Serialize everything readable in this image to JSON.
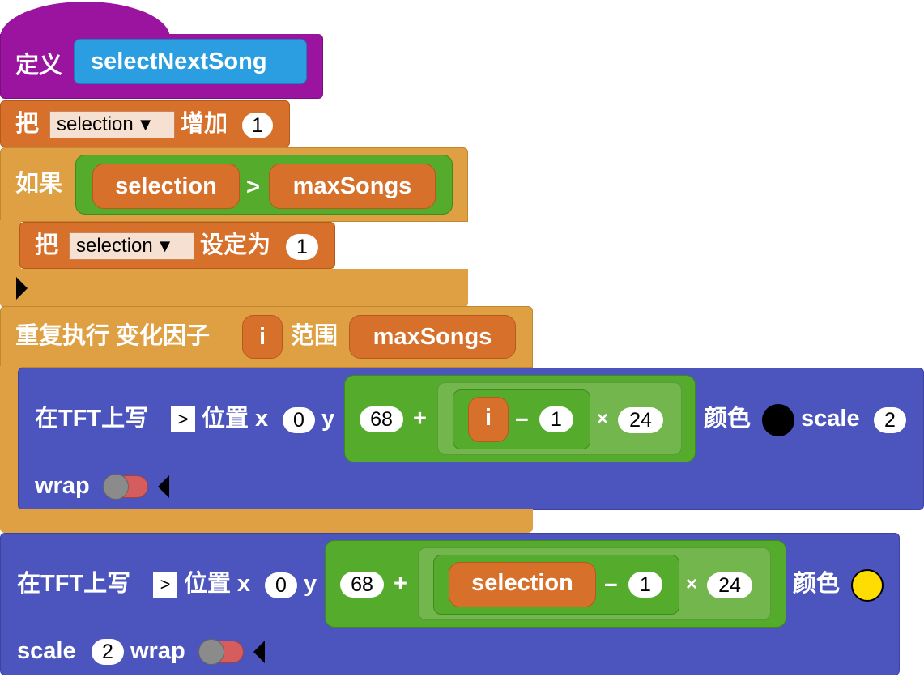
{
  "define_block": {
    "keyword": "定义",
    "name": "selectNextSong"
  },
  "change_block": {
    "keyword": "把",
    "variable": "selection",
    "action": "增加",
    "value": "1"
  },
  "if_block": {
    "keyword": "如果",
    "left": "selection",
    "operator": ">",
    "right": "maxSongs",
    "set_block": {
      "keyword": "把",
      "variable": "selection",
      "action": "设定为",
      "value": "1"
    }
  },
  "repeat_block": {
    "label": "重复执行 变化因子",
    "var": "i",
    "range_label": "范围",
    "range_value": "maxSongs",
    "tft_write": {
      "label": "在TFT上写",
      "text_value": ">",
      "pos_label": "位置 x",
      "x_value": "0",
      "y_label": "y",
      "expr": {
        "base": "68",
        "plus": "+",
        "var": "i",
        "minus": "−",
        "sub": "1",
        "times": "×",
        "mult": "24"
      },
      "color_label": "颜色",
      "color": "#000000",
      "scale_label": "scale",
      "scale_value": "2",
      "wrap_label": "wrap"
    }
  },
  "tft_write_2": {
    "label": "在TFT上写",
    "text_value": ">",
    "pos_label": "位置 x",
    "x_value": "0",
    "y_label": "y",
    "expr": {
      "base": "68",
      "plus": "+",
      "var": "selection",
      "minus": "−",
      "sub": "1",
      "times": "×",
      "mult": "24"
    },
    "color_label": "颜色",
    "color": "#ffdd00",
    "scale_label": "scale",
    "scale_value": "2",
    "wrap_label": "wrap"
  }
}
